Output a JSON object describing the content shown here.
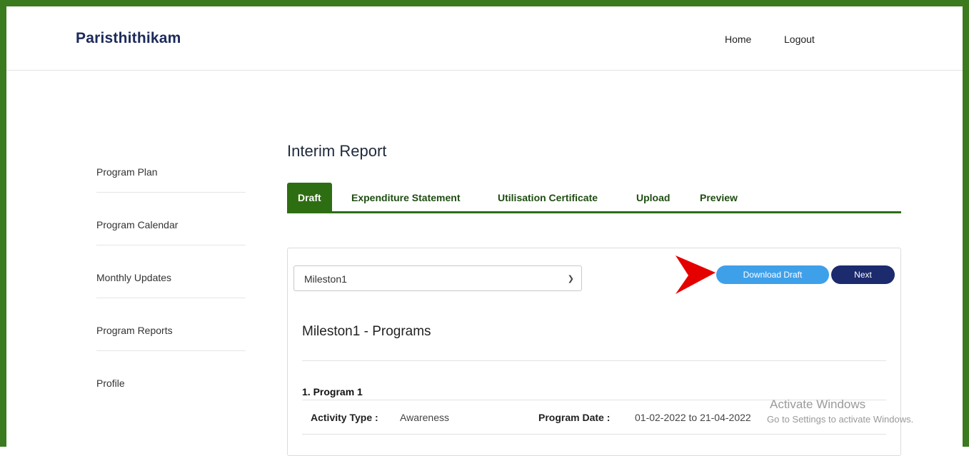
{
  "brand": "Paristhithikam",
  "nav": {
    "home": "Home",
    "logout": "Logout"
  },
  "sidebar": {
    "items": [
      {
        "label": "Program Plan"
      },
      {
        "label": "Program Calendar"
      },
      {
        "label": "Monthly Updates"
      },
      {
        "label": "Program Reports"
      },
      {
        "label": "Profile"
      }
    ]
  },
  "page": {
    "title": "Interim Report"
  },
  "tabs": [
    {
      "label": "Draft",
      "active": true
    },
    {
      "label": "Expenditure Statement"
    },
    {
      "label": "Utilisation Certificate"
    },
    {
      "label": "Upload"
    },
    {
      "label": "Preview"
    }
  ],
  "milestone_select": {
    "value": "Mileston1"
  },
  "buttons": {
    "download_draft": "Download Draft",
    "next": "Next"
  },
  "section": {
    "title": "Mileston1 - Programs"
  },
  "program": {
    "heading": "1. Program 1",
    "activity_type_label": "Activity Type :",
    "activity_type_value": "Awareness",
    "program_date_label": "Program Date :",
    "program_date_value": "01-02-2022 to 21-04-2022"
  },
  "watermark": {
    "line1": "Activate Windows",
    "line2": "Go to Settings to activate Windows."
  },
  "colors": {
    "frame_green": "#3b7a1f",
    "tab_green": "#2e6e12",
    "download_blue": "#3fa0ea",
    "next_navy": "#1c2a6e",
    "brand_navy": "#1c2a5a",
    "arrow_red": "#e50000"
  }
}
